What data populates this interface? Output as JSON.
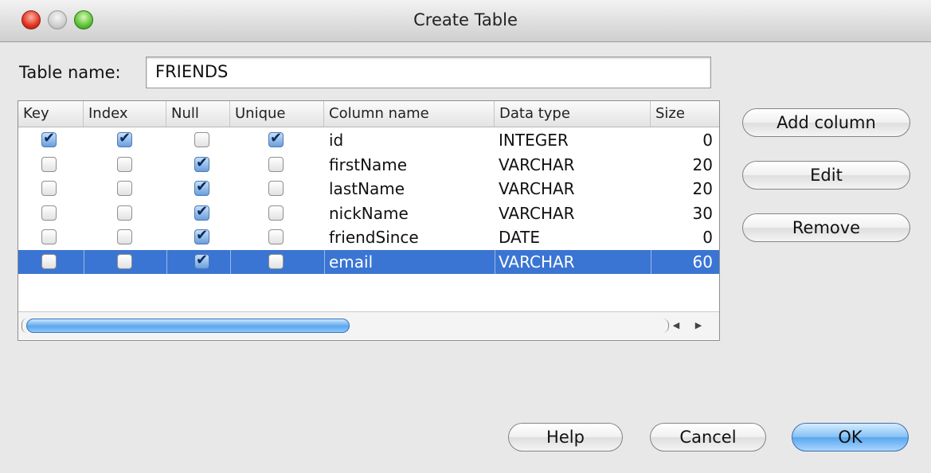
{
  "window": {
    "title": "Create Table"
  },
  "table_name": {
    "label": "Table name:",
    "value": "FRIENDS"
  },
  "columns_table": {
    "headers": [
      "Key",
      "Index",
      "Null",
      "Unique",
      "Column name",
      "Data type",
      "Size"
    ],
    "rows": [
      {
        "key": true,
        "index": true,
        "null": false,
        "unique": true,
        "name": "id",
        "type": "INTEGER",
        "size": "0",
        "selected": false
      },
      {
        "key": false,
        "index": false,
        "null": true,
        "unique": false,
        "name": "firstName",
        "type": "VARCHAR",
        "size": "20",
        "selected": false
      },
      {
        "key": false,
        "index": false,
        "null": true,
        "unique": false,
        "name": "lastName",
        "type": "VARCHAR",
        "size": "20",
        "selected": false
      },
      {
        "key": false,
        "index": false,
        "null": true,
        "unique": false,
        "name": "nickName",
        "type": "VARCHAR",
        "size": "30",
        "selected": false
      },
      {
        "key": false,
        "index": false,
        "null": true,
        "unique": false,
        "name": "friendSince",
        "type": "DATE",
        "size": "0",
        "selected": false
      },
      {
        "key": false,
        "index": false,
        "null": true,
        "unique": false,
        "name": "email",
        "type": "VARCHAR",
        "size": "60",
        "selected": true
      }
    ]
  },
  "side_buttons": {
    "add": "Add column",
    "edit": "Edit",
    "remove": "Remove"
  },
  "footer_buttons": {
    "help": "Help",
    "cancel": "Cancel",
    "ok": "OK"
  },
  "colors": {
    "selection": "#3a75d3",
    "default_button": "#58a6ee"
  }
}
